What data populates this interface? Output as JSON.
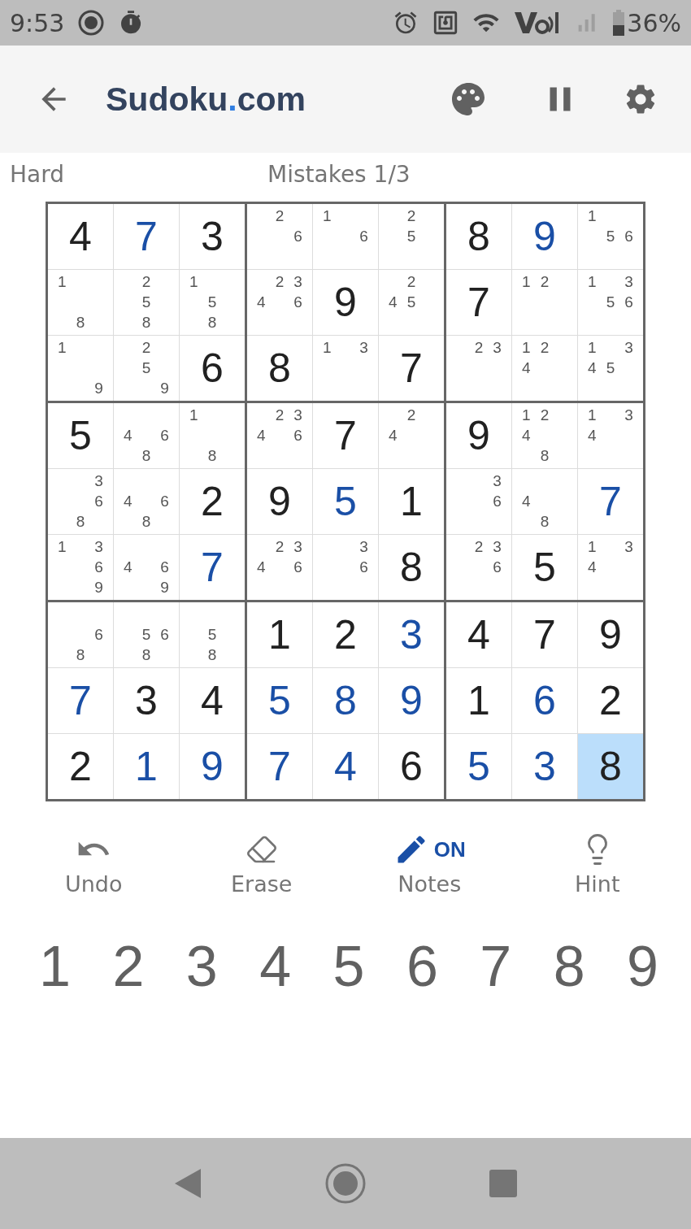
{
  "status_bar": {
    "time": "9:53",
    "battery": "36%"
  },
  "header": {
    "title_parts": [
      "Sudoku",
      ".",
      "com"
    ]
  },
  "info": {
    "difficulty": "Hard",
    "mistakes": "Mistakes 1/3"
  },
  "grid": [
    [
      {
        "kind": "given",
        "value": "4",
        "selected": false
      },
      {
        "kind": "entered",
        "value": "7",
        "selected": false
      },
      {
        "kind": "given",
        "value": "3",
        "selected": false
      },
      {
        "kind": "notes",
        "notes": [
          "2",
          "6"
        ],
        "selected": false
      },
      {
        "kind": "notes",
        "notes": [
          "1",
          "6"
        ],
        "selected": false
      },
      {
        "kind": "notes",
        "notes": [
          "2",
          "5"
        ],
        "selected": false
      },
      {
        "kind": "given",
        "value": "8",
        "selected": false
      },
      {
        "kind": "entered",
        "value": "9",
        "selected": false
      },
      {
        "kind": "notes",
        "notes": [
          "1",
          "5",
          "6"
        ],
        "selected": false
      }
    ],
    [
      {
        "kind": "notes",
        "notes": [
          "1",
          "8"
        ],
        "selected": false
      },
      {
        "kind": "notes",
        "notes": [
          "2",
          "5",
          "8"
        ],
        "selected": false
      },
      {
        "kind": "notes",
        "notes": [
          "1",
          "5",
          "8"
        ],
        "selected": false
      },
      {
        "kind": "notes",
        "notes": [
          "2",
          "3",
          "4",
          "6"
        ],
        "selected": false
      },
      {
        "kind": "given",
        "value": "9",
        "selected": false
      },
      {
        "kind": "notes",
        "notes": [
          "2",
          "4",
          "5"
        ],
        "selected": false
      },
      {
        "kind": "given",
        "value": "7",
        "selected": false
      },
      {
        "kind": "notes",
        "notes": [
          "1",
          "2"
        ],
        "selected": false
      },
      {
        "kind": "notes",
        "notes": [
          "1",
          "3",
          "5",
          "6"
        ],
        "selected": false
      }
    ],
    [
      {
        "kind": "notes",
        "notes": [
          "1",
          "9"
        ],
        "selected": false
      },
      {
        "kind": "notes",
        "notes": [
          "2",
          "5",
          "9"
        ],
        "selected": false
      },
      {
        "kind": "given",
        "value": "6",
        "selected": false
      },
      {
        "kind": "given",
        "value": "8",
        "selected": false
      },
      {
        "kind": "notes",
        "notes": [
          "1",
          "3"
        ],
        "selected": false
      },
      {
        "kind": "given",
        "value": "7",
        "selected": false
      },
      {
        "kind": "notes",
        "notes": [
          "2",
          "3"
        ],
        "selected": false
      },
      {
        "kind": "notes",
        "notes": [
          "1",
          "2",
          "4"
        ],
        "selected": false
      },
      {
        "kind": "notes",
        "notes": [
          "1",
          "3",
          "4",
          "5"
        ],
        "selected": false
      }
    ],
    [
      {
        "kind": "given",
        "value": "5",
        "selected": false
      },
      {
        "kind": "notes",
        "notes": [
          "4",
          "6",
          "8"
        ],
        "selected": false
      },
      {
        "kind": "notes",
        "notes": [
          "1",
          "8"
        ],
        "selected": false
      },
      {
        "kind": "notes",
        "notes": [
          "2",
          "3",
          "4",
          "6"
        ],
        "selected": false
      },
      {
        "kind": "given",
        "value": "7",
        "selected": false
      },
      {
        "kind": "notes",
        "notes": [
          "2",
          "4"
        ],
        "selected": false
      },
      {
        "kind": "given",
        "value": "9",
        "selected": false
      },
      {
        "kind": "notes",
        "notes": [
          "1",
          "2",
          "4",
          "8"
        ],
        "selected": false
      },
      {
        "kind": "notes",
        "notes": [
          "1",
          "3",
          "4"
        ],
        "selected": false
      }
    ],
    [
      {
        "kind": "notes",
        "notes": [
          "3",
          "6",
          "8"
        ],
        "selected": false
      },
      {
        "kind": "notes",
        "notes": [
          "4",
          "6",
          "8"
        ],
        "selected": false
      },
      {
        "kind": "given",
        "value": "2",
        "selected": false
      },
      {
        "kind": "given",
        "value": "9",
        "selected": false
      },
      {
        "kind": "entered",
        "value": "5",
        "selected": false
      },
      {
        "kind": "given",
        "value": "1",
        "selected": false
      },
      {
        "kind": "notes",
        "notes": [
          "3",
          "6"
        ],
        "selected": false
      },
      {
        "kind": "notes",
        "notes": [
          "4",
          "8"
        ],
        "selected": false
      },
      {
        "kind": "entered",
        "value": "7",
        "selected": false
      }
    ],
    [
      {
        "kind": "notes",
        "notes": [
          "1",
          "3",
          "6",
          "9"
        ],
        "selected": false
      },
      {
        "kind": "notes",
        "notes": [
          "4",
          "6",
          "9"
        ],
        "selected": false
      },
      {
        "kind": "entered",
        "value": "7",
        "selected": false
      },
      {
        "kind": "notes",
        "notes": [
          "2",
          "3",
          "4",
          "6"
        ],
        "selected": false
      },
      {
        "kind": "notes",
        "notes": [
          "3",
          "6"
        ],
        "selected": false
      },
      {
        "kind": "given",
        "value": "8",
        "selected": false
      },
      {
        "kind": "notes",
        "notes": [
          "2",
          "3",
          "6"
        ],
        "selected": false
      },
      {
        "kind": "given",
        "value": "5",
        "selected": false
      },
      {
        "kind": "notes",
        "notes": [
          "1",
          "3",
          "4"
        ],
        "selected": false
      }
    ],
    [
      {
        "kind": "notes",
        "notes": [
          "6",
          "8"
        ],
        "selected": false
      },
      {
        "kind": "notes",
        "notes": [
          "5",
          "6",
          "8"
        ],
        "selected": false
      },
      {
        "kind": "notes",
        "notes": [
          "5",
          "8"
        ],
        "selected": false
      },
      {
        "kind": "given",
        "value": "1",
        "selected": false
      },
      {
        "kind": "given",
        "value": "2",
        "selected": false
      },
      {
        "kind": "entered",
        "value": "3",
        "selected": false
      },
      {
        "kind": "given",
        "value": "4",
        "selected": false
      },
      {
        "kind": "given",
        "value": "7",
        "selected": false
      },
      {
        "kind": "given",
        "value": "9",
        "selected": false
      }
    ],
    [
      {
        "kind": "entered",
        "value": "7",
        "selected": false
      },
      {
        "kind": "given",
        "value": "3",
        "selected": false
      },
      {
        "kind": "given",
        "value": "4",
        "selected": false
      },
      {
        "kind": "entered",
        "value": "5",
        "selected": false
      },
      {
        "kind": "entered",
        "value": "8",
        "selected": false
      },
      {
        "kind": "entered",
        "value": "9",
        "selected": false
      },
      {
        "kind": "given",
        "value": "1",
        "selected": false
      },
      {
        "kind": "entered",
        "value": "6",
        "selected": false
      },
      {
        "kind": "given",
        "value": "2",
        "selected": false
      }
    ],
    [
      {
        "kind": "given",
        "value": "2",
        "selected": false
      },
      {
        "kind": "entered",
        "value": "1",
        "selected": false
      },
      {
        "kind": "entered",
        "value": "9",
        "selected": false
      },
      {
        "kind": "entered",
        "value": "7",
        "selected": false
      },
      {
        "kind": "entered",
        "value": "4",
        "selected": false
      },
      {
        "kind": "given",
        "value": "6",
        "selected": false
      },
      {
        "kind": "entered",
        "value": "5",
        "selected": false
      },
      {
        "kind": "entered",
        "value": "3",
        "selected": false
      },
      {
        "kind": "given",
        "value": "8",
        "selected": true
      }
    ]
  ],
  "tools": [
    {
      "kind": "undo",
      "label": "Undo"
    },
    {
      "kind": "erase",
      "label": "Erase"
    },
    {
      "kind": "notes",
      "label": "Notes",
      "on": true,
      "badge": "ON"
    },
    {
      "kind": "hint",
      "label": "Hint"
    }
  ],
  "number_pad": [
    "1",
    "2",
    "3",
    "4",
    "5",
    "6",
    "7",
    "8",
    "9"
  ]
}
